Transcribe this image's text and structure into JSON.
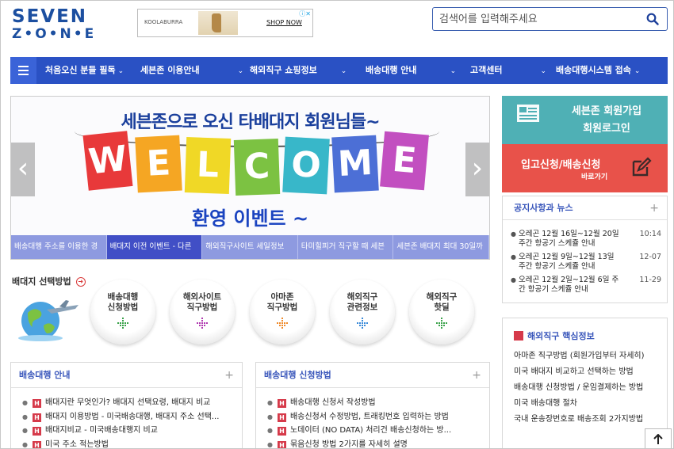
{
  "logo": {
    "line1": "SEVEN",
    "line2": "Z•O•N•E"
  },
  "ad": {
    "brand": "KOOLABURRA",
    "cta": "SHOP NOW",
    "badge": "ⓘ✕"
  },
  "search": {
    "placeholder": "검색어를 입력해주세요"
  },
  "nav": {
    "items": [
      {
        "label": "처음오신 분들 필독",
        "chevron": "⌄"
      },
      {
        "label": "세븐존 이용안내",
        "chevron": "⌄"
      },
      {
        "label": "해외직구 쇼핑정보",
        "chevron": "⌄"
      },
      {
        "label": "배송대행 안내",
        "chevron": "⌄"
      },
      {
        "label": "고객센터",
        "chevron": "⌄"
      },
      {
        "label": "배송대행시스템 접속",
        "chevron": "⌄"
      }
    ]
  },
  "slider": {
    "title": "세븐존으로 오신 타배대지 회원님들~",
    "letters": [
      "W",
      "E",
      "L",
      "C",
      "O",
      "M",
      "E"
    ],
    "subtitle": "환영 이벤트 ~",
    "prev": "‹",
    "next": "›",
    "tabs": [
      "배송대행 주소를 이용한 경",
      "배대지 이전 이벤트 - 다른",
      "해외직구사이트 세일정보",
      "타미힐피거 직구할 때 세븐",
      "세븐존 배대지 최대 30일까"
    ],
    "active_tab": 1
  },
  "selection": {
    "title": "배대지 선택방법",
    "circles": [
      {
        "line1": "배송대행",
        "line2": "신청방법",
        "color": "#3aa24a"
      },
      {
        "line1": "해외사이트",
        "line2": "직구방법",
        "color": "#b03ab0"
      },
      {
        "line1": "아마존",
        "line2": "직구방법",
        "color": "#ef8a2a"
      },
      {
        "line1": "해외직구",
        "line2": "관련정보",
        "color": "#3a8ad8"
      },
      {
        "line1": "해외직구",
        "line2": "핫딜",
        "color": "#3aa24a"
      }
    ]
  },
  "guide_box": {
    "title": "배송대행 안내",
    "items": [
      "배대지란 무엇인가? 배대지 선택요령, 배대지 비교",
      "배대지 이용방법 - 미국배송대행, 배대지 주소 선택...",
      "배대지비교 - 미국배송대행지 비교",
      "미국 주소 적는방법"
    ]
  },
  "apply_box": {
    "title": "배송대행 신청방법",
    "items": [
      "배송대행 신청서 작성방법",
      "배송신청서 수정방법, 트래킹번호 입력하는 방법",
      "노데이터 (NO DATA) 처리건 배송신청하는 방...",
      "묶음신청 방법 2가지를 자세히 설명"
    ]
  },
  "member": {
    "line1": "세븐존 회원가입",
    "line2": "회원로그인"
  },
  "apply_cta": {
    "line1": "입고신청/배송신청",
    "line2": "바로가기"
  },
  "notice": {
    "title": "공지사항과 뉴스",
    "items": [
      {
        "text": "오레곤 12월 16일~12월 20일 주간 항공기 스케쥴 안내",
        "date": "10:14"
      },
      {
        "text": "오레곤 12월 9일~12월 13일 주간 항공기 스케쥴 안내",
        "date": "12-07"
      },
      {
        "text": "오레곤 12월 2일~12월 6일 주간 항공기 스케쥴 안내",
        "date": "11-29"
      }
    ]
  },
  "core": {
    "title": "해외직구 핵심정보",
    "items": [
      "아마존 직구방법 (회원가입부터 자세히)",
      "미국 배대지 비교하고 선택하는 방법",
      "배송대행 신청방법 / 운임결제하는 방법",
      "미국 배송대행 절차",
      "국내 운송장번호로 배송조회 2가지방법"
    ]
  },
  "colors": {
    "brand": "#1c4fa0",
    "nav": "#2a51c4",
    "teal": "#4fb0b5",
    "red": "#e8524a"
  }
}
